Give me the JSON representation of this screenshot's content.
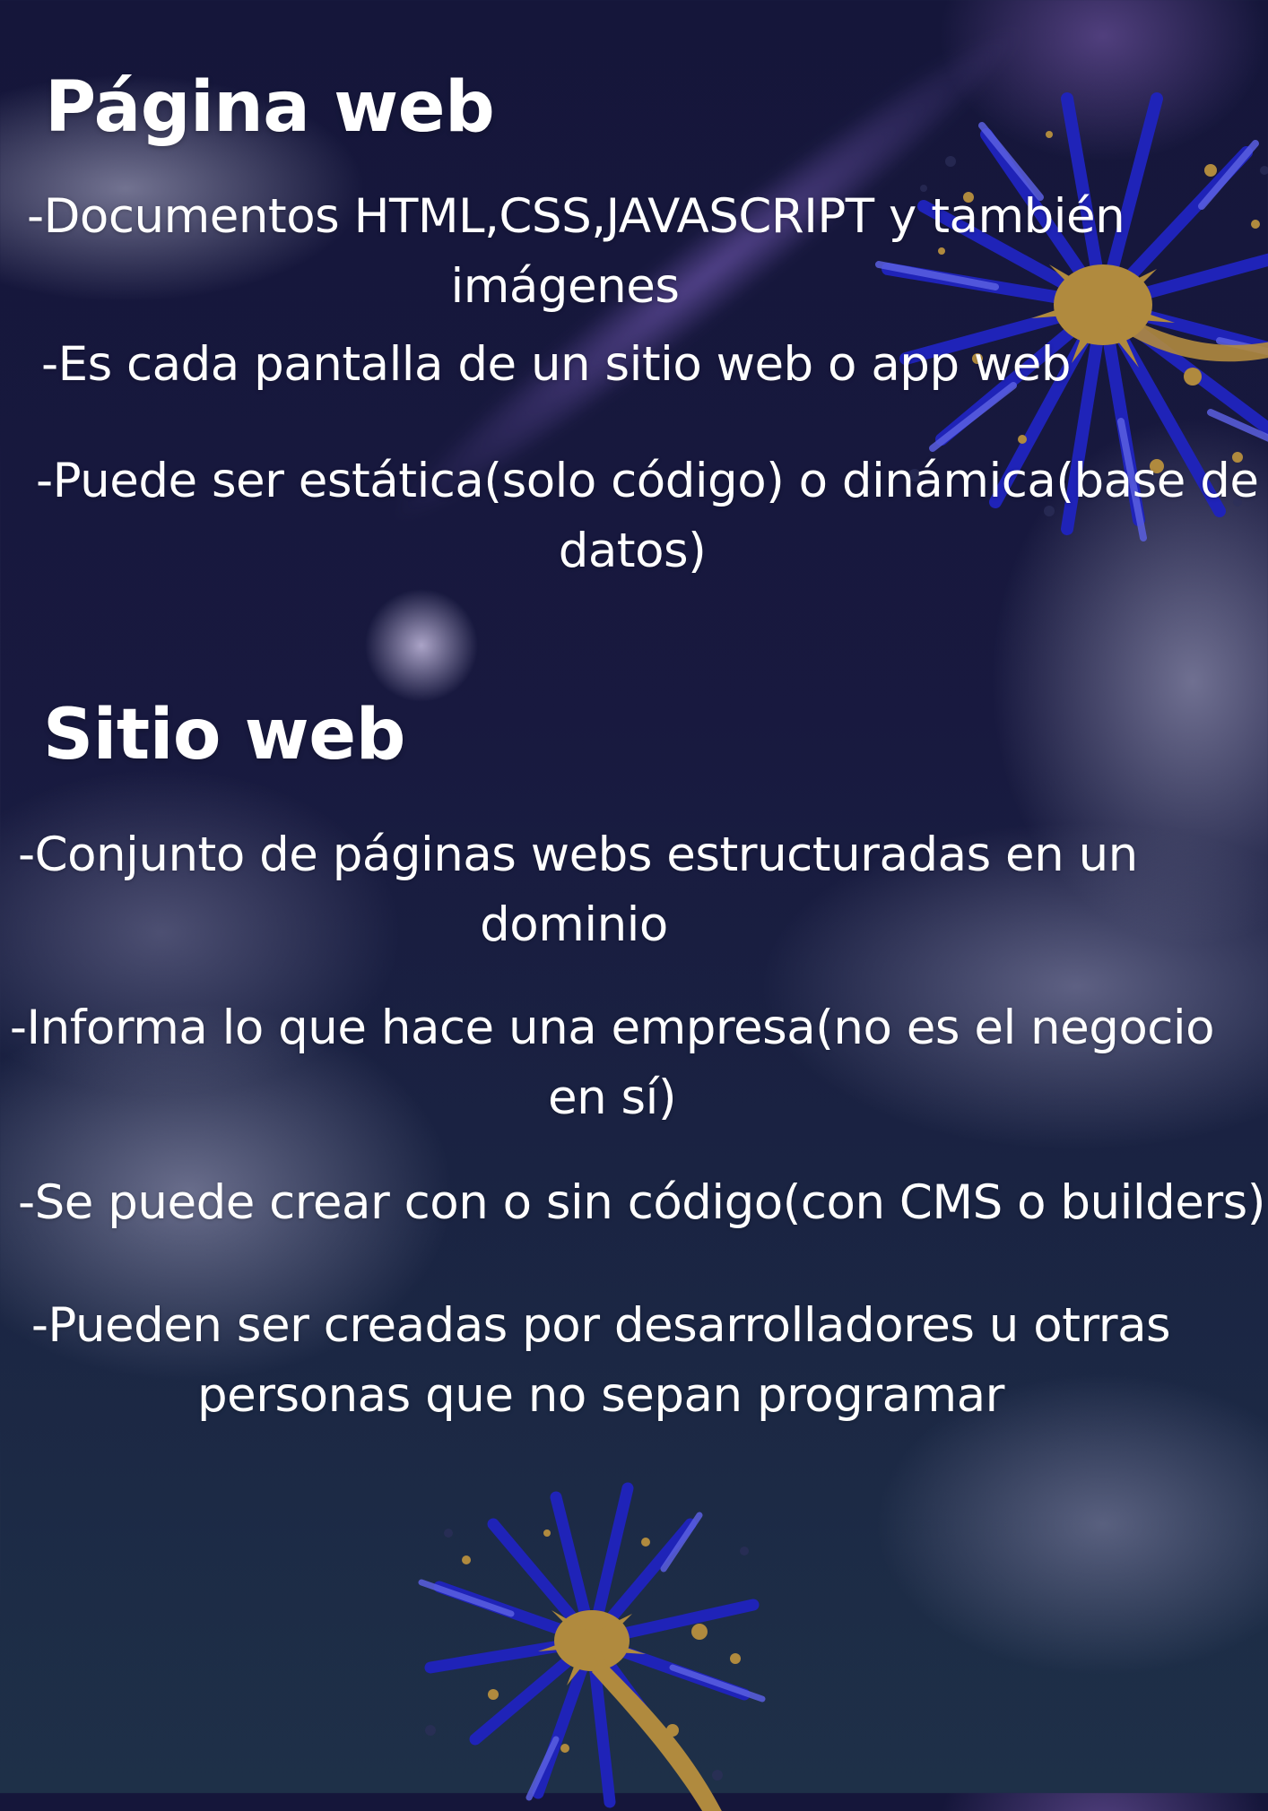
{
  "section_pagina": {
    "title": "Página web",
    "items": [
      {
        "line1": "-Documentos HTML,CSS,JAVASCRIPT  y también",
        "line2": "imágenes"
      },
      {
        "line1": "-Es cada pantalla de un sitio web o app web"
      },
      {
        "line1": "-Puede ser estática(solo código) o dinámica(base de",
        "line2": "datos)"
      }
    ]
  },
  "section_sitio": {
    "title": "Sitio web",
    "items": [
      {
        "line1": "-Conjunto de páginas webs estructuradas en un",
        "line2": "dominio"
      },
      {
        "line1": "-Informa lo que hace una empresa(no es el  negocio",
        "line2": "en sí)"
      },
      {
        "line1": "-Se puede crear con o sin código(con CMS o builders)"
      },
      {
        "line1": "-Pueden ser creadas por desarrolladores u otrras",
        "line2": "personas que no sepan programar"
      }
    ]
  },
  "decor": {
    "firework_blue": "#1f23b8",
    "firework_light_blue": "#4b4fd8",
    "firework_gold": "#b08a3e"
  }
}
